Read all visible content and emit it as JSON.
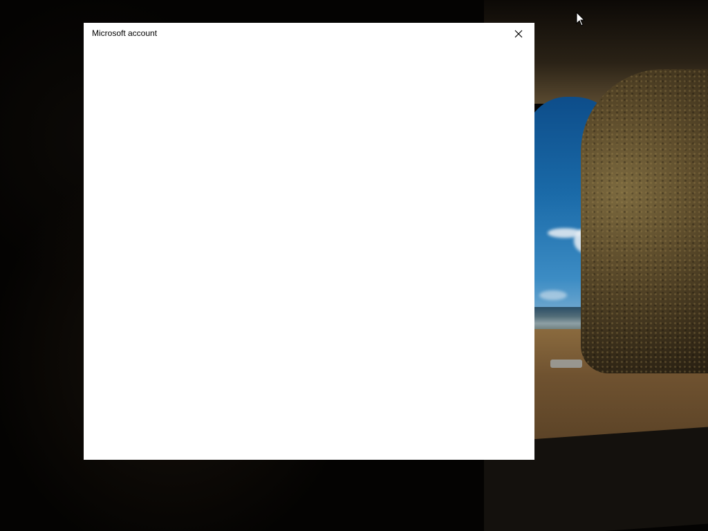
{
  "window": {
    "title": "Microsoft account",
    "close_icon": "close-icon"
  },
  "cursor": {
    "icon": "mouse-pointer-icon"
  },
  "colors": {
    "dialog_background": "#ffffff",
    "title_text": "#000000",
    "desktop_background": "#040302"
  }
}
